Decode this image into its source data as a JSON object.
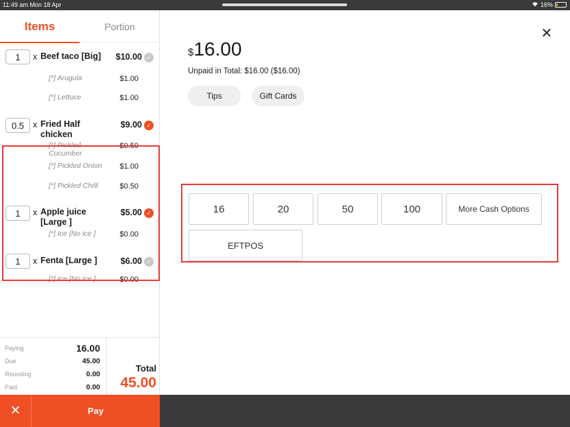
{
  "status": {
    "time": "11:49 am  Mon 18 Apr",
    "battery": "16%",
    "battery_level": 0.16
  },
  "tabs": {
    "items": "Items",
    "portion": "Portion"
  },
  "order_items": [
    {
      "qty": "1",
      "x": "x",
      "name": "Beef taco [Big]",
      "price": "$10.00",
      "checked": false,
      "modifiers": [
        {
          "name": "[*] Arugula",
          "price": "$1.00"
        },
        {
          "name": "[*] Lettuce",
          "price": "$1.00"
        }
      ]
    },
    {
      "qty": "0.5",
      "x": "x",
      "name": "Fried Half chicken",
      "price": "$9.00",
      "checked": true,
      "modifiers": [
        {
          "name": "[*] Pickled Cucumber",
          "price": "$0.50"
        },
        {
          "name": "[*] Pickled Onion",
          "price": "$1.00"
        },
        {
          "name": "[*] Pickled Chilli",
          "price": "$0.50"
        }
      ]
    },
    {
      "qty": "1",
      "x": "x",
      "name": "Apple juice [Large ]",
      "price": "$5.00",
      "checked": true,
      "modifiers": [
        {
          "name": "[*] Ice  [No ice ]",
          "price": "$0.00"
        }
      ]
    },
    {
      "qty": "1",
      "x": "x",
      "name": "Fenta  [Large ]",
      "price": "$6.00",
      "checked": false,
      "modifiers": [
        {
          "name": "[*] Ice  [No ice ]",
          "price": "$0.00"
        }
      ]
    }
  ],
  "totals": {
    "paying_label": "Paying",
    "paying": "16.00",
    "due_label": "Due",
    "due": "45.00",
    "rounding_label": "Rounding",
    "rounding": "0.00",
    "paid_label": "Paid",
    "paid": "0.00",
    "total_label": "Total",
    "total": "45.00"
  },
  "bottom": {
    "cancel_icon": "close-icon",
    "pay_label": "Pay"
  },
  "payment": {
    "currency": "$",
    "amount": "16.00",
    "unpaid": "Unpaid in Total: $16.00 ($16.00)",
    "tips_label": "Tips",
    "gift_cards_label": "Gift Cards",
    "cash_options": [
      "16",
      "20",
      "50",
      "100"
    ],
    "more_cash_label": "More Cash Options",
    "eftpos_label": "EFTPOS"
  },
  "colors": {
    "accent": "#f04e23",
    "highlight": "#e53935",
    "bar": "#3a3a3c"
  }
}
